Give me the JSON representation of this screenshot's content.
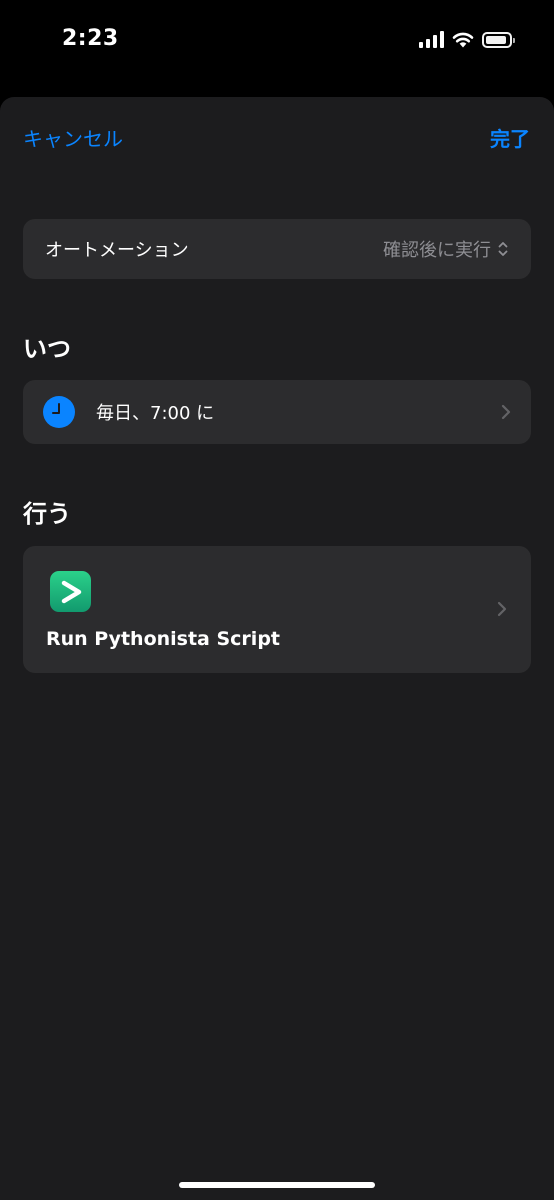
{
  "status_bar": {
    "time": "2:23",
    "icons": [
      "signal-icon",
      "wifi-icon",
      "battery-icon"
    ]
  },
  "nav": {
    "cancel_label": "キャンセル",
    "done_label": "完了"
  },
  "automation": {
    "label": "オートメーション",
    "value": "確認後に実行"
  },
  "when_section": {
    "header": "いつ",
    "schedule": "毎日、7:00 に",
    "icon": "clock-icon"
  },
  "do_section": {
    "header": "行う",
    "action_label": "Run Pythonista Script",
    "icon": "pythonista-app-icon"
  },
  "colors": {
    "accent": "#0a84ff",
    "sheet_background": "#1c1c1e",
    "card_background": "#2c2c2e",
    "secondary_text": "#8e8e93",
    "app_icon_green": "#1fb97c"
  }
}
